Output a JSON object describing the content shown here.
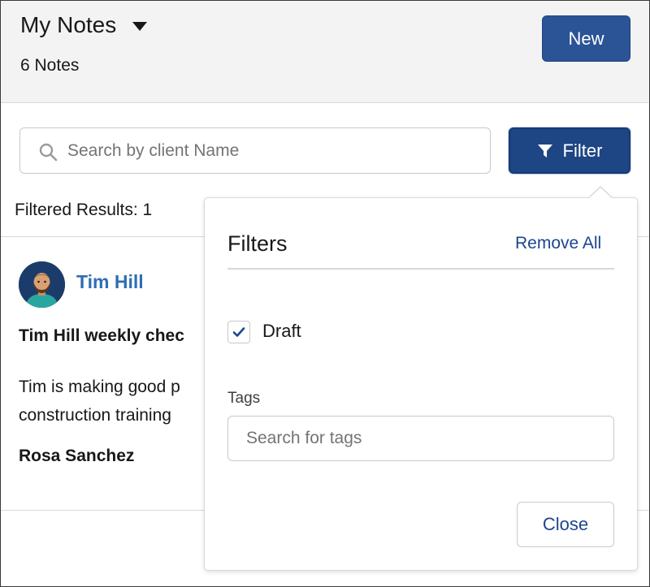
{
  "header": {
    "title": "My Notes",
    "count_label": "6 Notes",
    "new_button": "New"
  },
  "search": {
    "placeholder": "Search by client Name",
    "value": ""
  },
  "filter_button": "Filter",
  "results_label": "Filtered Results: 1",
  "note": {
    "client_name": "Tim Hill",
    "title": "Tim Hill weekly chec",
    "body_line1": "Tim is making good p",
    "body_line2": "construction training",
    "author": "Rosa Sanchez"
  },
  "filters_panel": {
    "title": "Filters",
    "remove_all": "Remove All",
    "draft_label": "Draft",
    "draft_checked": true,
    "tags_label": "Tags",
    "tags_placeholder": "Search for tags",
    "close_button": "Close"
  },
  "colors": {
    "brand": "#2a5496",
    "link": "#2f6db5",
    "header_bg": "#f3f3f3"
  },
  "icons": {
    "title_dropdown": "caret-down-icon",
    "search": "search-icon",
    "filter": "filter-funnel-icon",
    "checkbox": "check-icon",
    "avatar": "avatar-man-beard"
  }
}
